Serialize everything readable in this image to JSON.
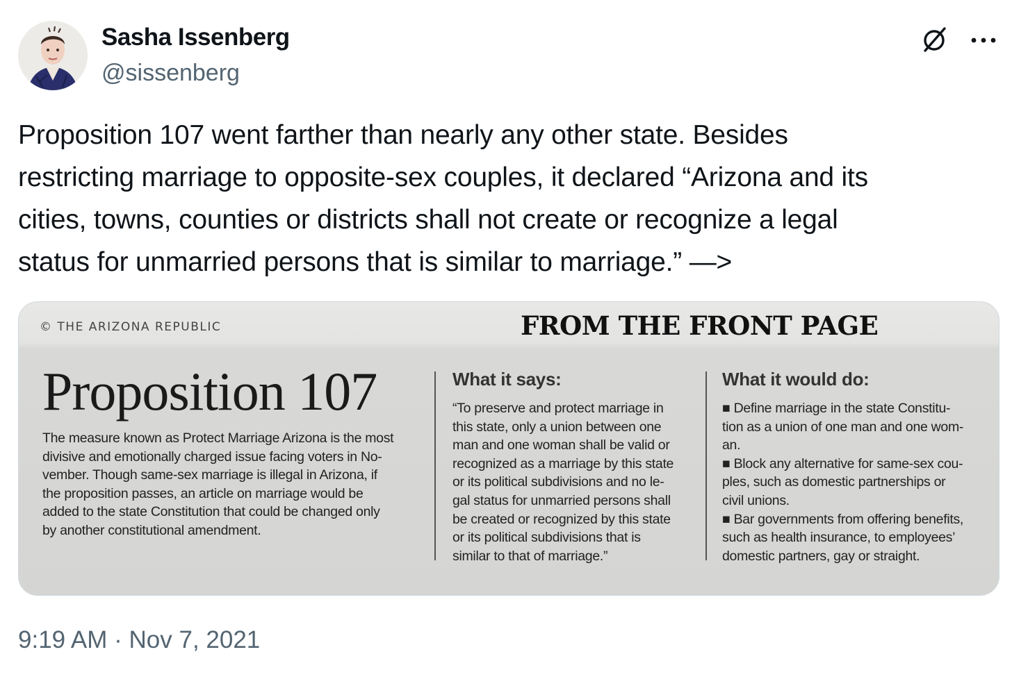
{
  "author": {
    "display_name": "Sasha Issenberg",
    "handle": "@sissenberg"
  },
  "tweet": {
    "text_lines": [
      "Proposition 107 went farther than nearly any other state. Besides",
      "restricting marriage to opposite-sex couples, it declared “Arizona and its",
      "cities, towns, counties or districts shall not create or recognize a legal",
      "status for unmarried persons that is similar to marriage.” —>"
    ],
    "timestamp": "9:19 AM · Nov 7, 2021"
  },
  "icons": {
    "grok": "grok-icon",
    "more": "more-icon"
  },
  "newspaper_clip": {
    "copyright": "© THE ARIZONA REPUBLIC",
    "section_title": "FROM THE FRONT PAGE",
    "headline": "Proposition 107",
    "body_lines": [
      "The measure known as Protect Marriage Arizona is the most",
      "divisive and emotionally charged issue facing voters in No-",
      "vember. Though same-sex marriage is illegal in Arizona, if",
      "the proposition passes, an article on marriage would be",
      "added to the state Constitution that could be changed only",
      "by another constitutional amendment."
    ],
    "what_it_says": {
      "heading": "What it says:",
      "lines": [
        "“To preserve and protect marriage in",
        "this state, only a union between one",
        "man and one woman shall be valid or",
        "recognized as a marriage by this state",
        "or its political subdivisions and no le-",
        "gal status for unmarried persons shall",
        "be created or recognized by this state",
        "or its political subdivisions that is",
        "similar to that of marriage.”"
      ]
    },
    "what_it_would_do": {
      "heading": "What it would do:",
      "lines": [
        "■ Define marriage in the state Constitu-",
        "tion as a union of one man and one wom-",
        "an.",
        "■ Block any alternative for same-sex cou-",
        "ples, such as domestic partnerships or",
        "civil unions.",
        "■ Bar governments from offering benefits,",
        "such as health insurance, to employees’",
        "domestic partners, gay or straight."
      ]
    }
  },
  "colors": {
    "text_primary": "#0f1419",
    "text_secondary": "#536471",
    "border": "#cfd9de"
  }
}
